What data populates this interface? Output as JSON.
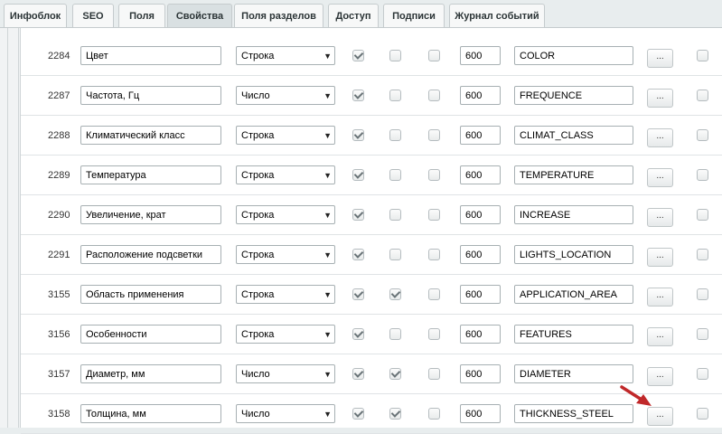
{
  "tabs": [
    {
      "label": "Инфоблок",
      "active": false
    },
    {
      "label": "SEO",
      "active": false
    },
    {
      "label": "Поля",
      "active": false
    },
    {
      "label": "Свойства",
      "active": true
    },
    {
      "label": "Поля разделов",
      "active": false
    },
    {
      "label": "Доступ",
      "active": false
    },
    {
      "label": "Подписи",
      "active": false
    },
    {
      "label": "Журнал событий",
      "active": false
    }
  ],
  "edit_button_label": "...",
  "rows": [
    {
      "id": "2284",
      "name": "Цвет",
      "type": "Строка",
      "check1": true,
      "check2": false,
      "check3": false,
      "sort": "600",
      "code": "COLOR",
      "check4": false
    },
    {
      "id": "2287",
      "name": "Частота, Гц",
      "type": "Число",
      "check1": true,
      "check2": false,
      "check3": false,
      "sort": "600",
      "code": "FREQUENCE",
      "check4": false
    },
    {
      "id": "2288",
      "name": "Климатический класс",
      "type": "Строка",
      "check1": true,
      "check2": false,
      "check3": false,
      "sort": "600",
      "code": "CLIMAT_CLASS",
      "check4": false
    },
    {
      "id": "2289",
      "name": "Температура",
      "type": "Строка",
      "check1": true,
      "check2": false,
      "check3": false,
      "sort": "600",
      "code": "TEMPERATURE",
      "check4": false
    },
    {
      "id": "2290",
      "name": "Увеличение, крат",
      "type": "Строка",
      "check1": true,
      "check2": false,
      "check3": false,
      "sort": "600",
      "code": "INCREASE",
      "check4": false
    },
    {
      "id": "2291",
      "name": "Расположение подсветки",
      "type": "Строка",
      "check1": true,
      "check2": false,
      "check3": false,
      "sort": "600",
      "code": "LIGHTS_LOCATION",
      "check4": false
    },
    {
      "id": "3155",
      "name": "Область применения",
      "type": "Строка",
      "check1": true,
      "check2": true,
      "check3": false,
      "sort": "600",
      "code": "APPLICATION_AREA",
      "check4": false
    },
    {
      "id": "3156",
      "name": "Особенности",
      "type": "Строка",
      "check1": true,
      "check2": false,
      "check3": false,
      "sort": "600",
      "code": "FEATURES",
      "check4": false
    },
    {
      "id": "3157",
      "name": "Диаметр, мм",
      "type": "Число",
      "check1": true,
      "check2": true,
      "check3": false,
      "sort": "600",
      "code": "DIAMETER",
      "check4": false
    },
    {
      "id": "3158",
      "name": "Толщина, мм",
      "type": "Число",
      "check1": true,
      "check2": true,
      "check3": false,
      "sort": "600",
      "code": "THICKNESS_STEEL",
      "check4": false
    }
  ],
  "colors": {
    "annotation_arrow": "#c0282a",
    "accent_tab": "#d9e0e2"
  }
}
